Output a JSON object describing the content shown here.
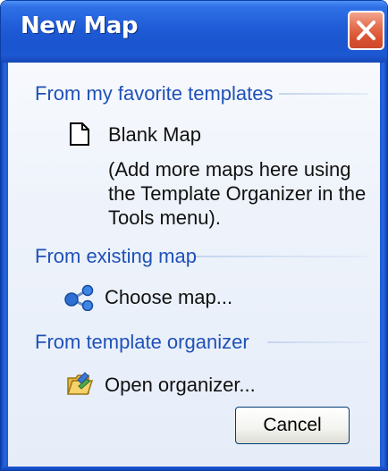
{
  "window": {
    "title": "New Map"
  },
  "sections": {
    "favorites": {
      "header": "From my favorite templates",
      "item_label": "Blank Map",
      "note": "(Add more maps here using the Template Organizer in the Tools menu)."
    },
    "existing": {
      "header": "From existing map",
      "item_label": "Choose map..."
    },
    "organizer": {
      "header": "From template organizer",
      "item_label": "Open organizer..."
    }
  },
  "buttons": {
    "cancel_label": "Cancel"
  },
  "icons": {
    "close": "close-icon",
    "blank_map": "blank-page-icon",
    "choose_map": "map-nodes-icon",
    "open_organizer": "folder-organizer-icon"
  },
  "colors": {
    "titlebar": "#1f5bd6",
    "section_header": "#1f51b8",
    "close_button": "#d8502f"
  }
}
